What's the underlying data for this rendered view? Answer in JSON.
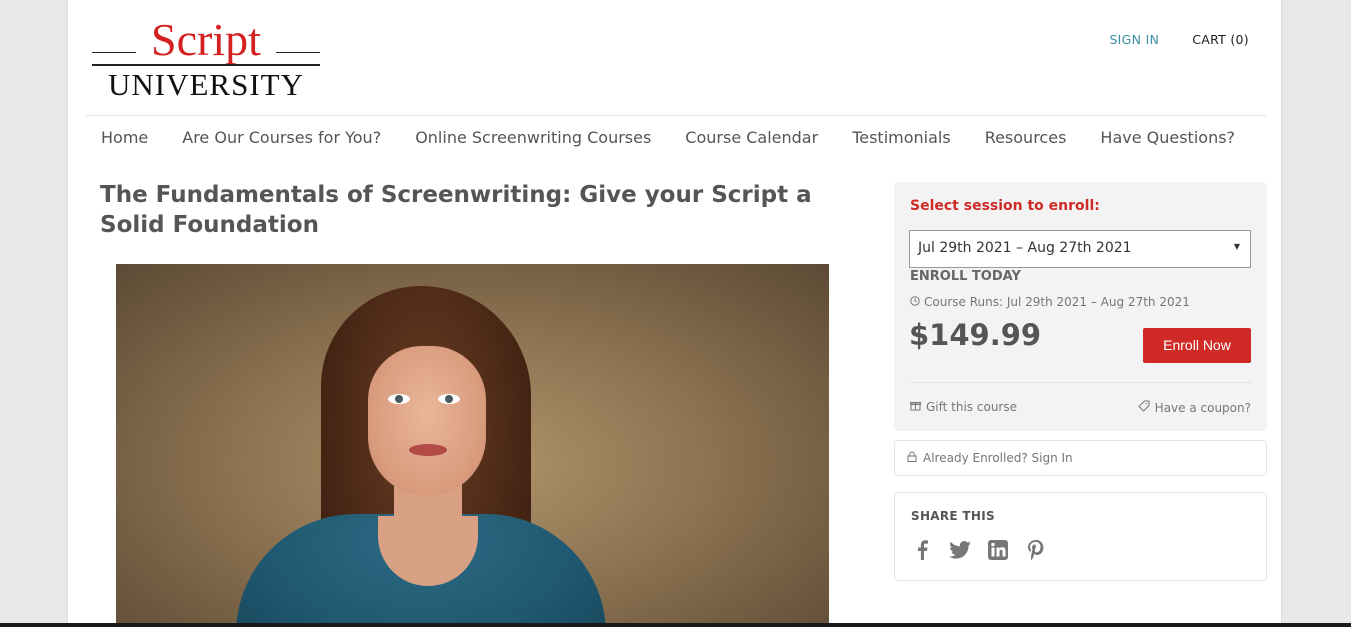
{
  "logo": {
    "line1": "Script",
    "line2": "UNIVERSITY"
  },
  "header": {
    "sign_in": "SIGN IN",
    "cart": "CART (0)"
  },
  "nav": {
    "items": [
      {
        "label": "Home"
      },
      {
        "label": "Are Our Courses for You?"
      },
      {
        "label": "Online Screenwriting Courses"
      },
      {
        "label": "Course Calendar"
      },
      {
        "label": "Testimonials"
      },
      {
        "label": "Resources"
      },
      {
        "label": "Have Questions?"
      }
    ]
  },
  "course": {
    "title": "The Fundamentals of Screenwriting: Give your Script a Solid Foundation"
  },
  "enroll": {
    "select_label": "Select session to enroll:",
    "session_value": "Jul 29th 2021 – Aug 27th 2021",
    "enroll_today": "ENROLL TODAY",
    "course_runs": "Course Runs: Jul 29th 2021 – Aug 27th 2021",
    "price": "$149.99",
    "enroll_button": "Enroll Now",
    "gift": "Gift this course",
    "coupon": "Have a coupon?"
  },
  "already_enrolled": "Already Enrolled? Sign In",
  "share": {
    "label": "SHARE THIS",
    "icons": [
      "facebook-icon",
      "twitter-icon",
      "linkedin-icon",
      "pinterest-icon"
    ]
  },
  "colors": {
    "brand_red": "#cf2a26",
    "link_teal": "#3a8ea5"
  }
}
